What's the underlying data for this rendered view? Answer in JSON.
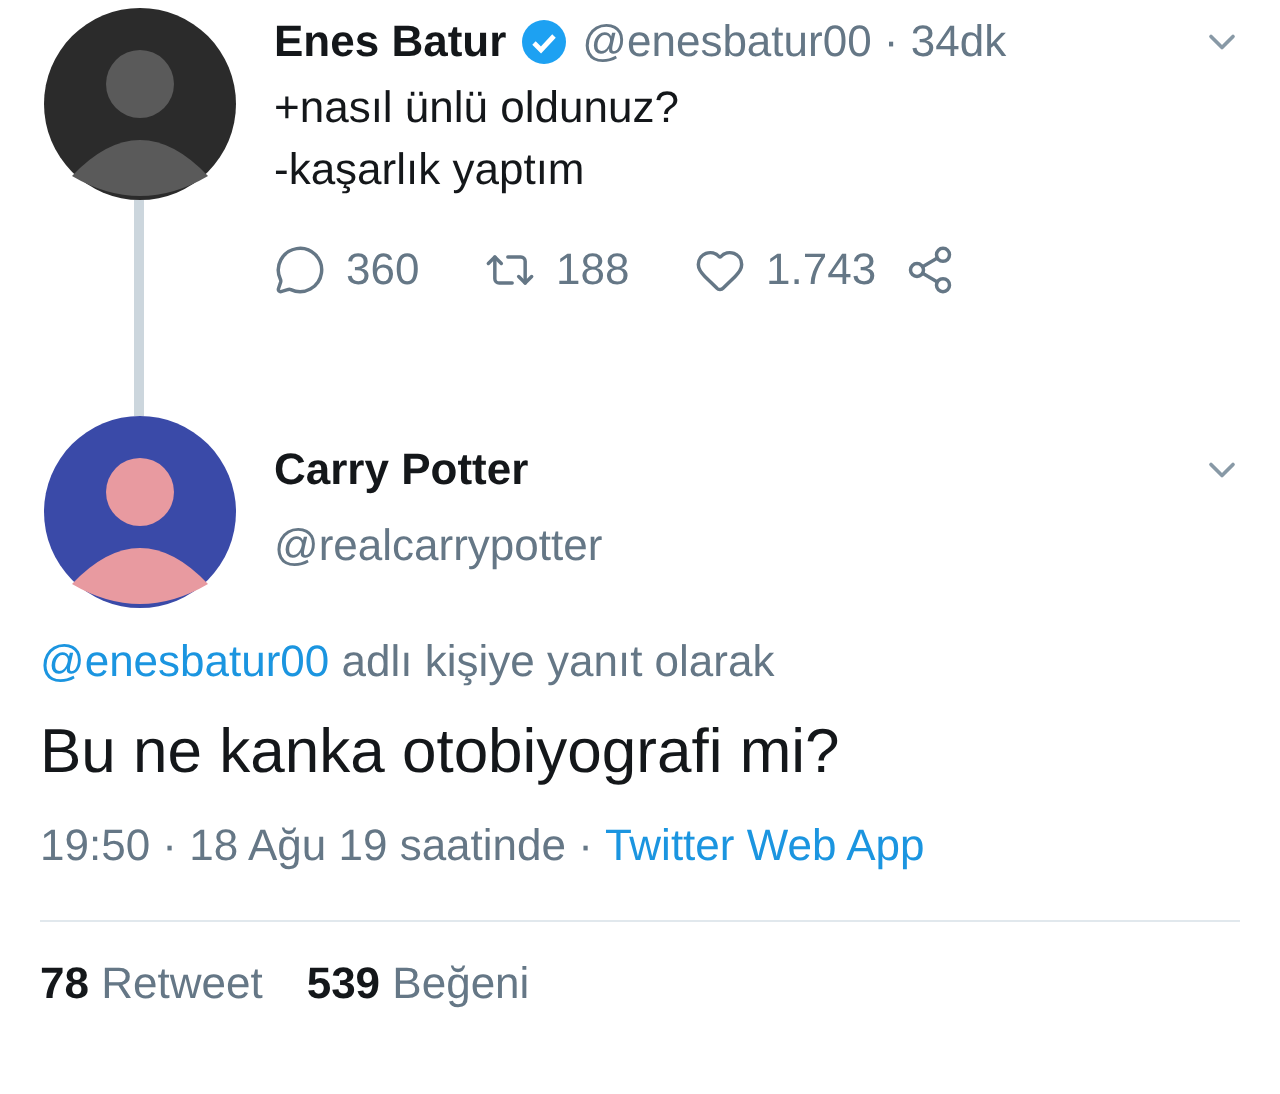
{
  "tweet": {
    "author": {
      "name": "Enes Batur",
      "verified": true,
      "handle_line": "@enesbatur00 · 34dk"
    },
    "lines": [
      "+nasıl ünlü oldunuz?",
      "-kaşarlık yaptım"
    ],
    "actions": [
      {
        "kind": "reply",
        "count": "360"
      },
      {
        "kind": "retweet",
        "count": "188"
      },
      {
        "kind": "like",
        "count": "1.743"
      },
      {
        "kind": "share"
      }
    ]
  },
  "reply": {
    "author": {
      "name": "Carry Potter",
      "handle": "@realcarrypotter"
    },
    "replying_to": {
      "handle": "@enesbatur00",
      "text": "adlı kişiye yanıt olarak"
    },
    "text": "Bu ne kanka otobiyografi mi?",
    "timestamp": "19:50 · 18 Ağu 19 saatinde ·",
    "source": "Twitter Web App",
    "stats": [
      {
        "count": "78",
        "label": "Retweet"
      },
      {
        "count": "539",
        "label": "Beğeni"
      }
    ]
  }
}
